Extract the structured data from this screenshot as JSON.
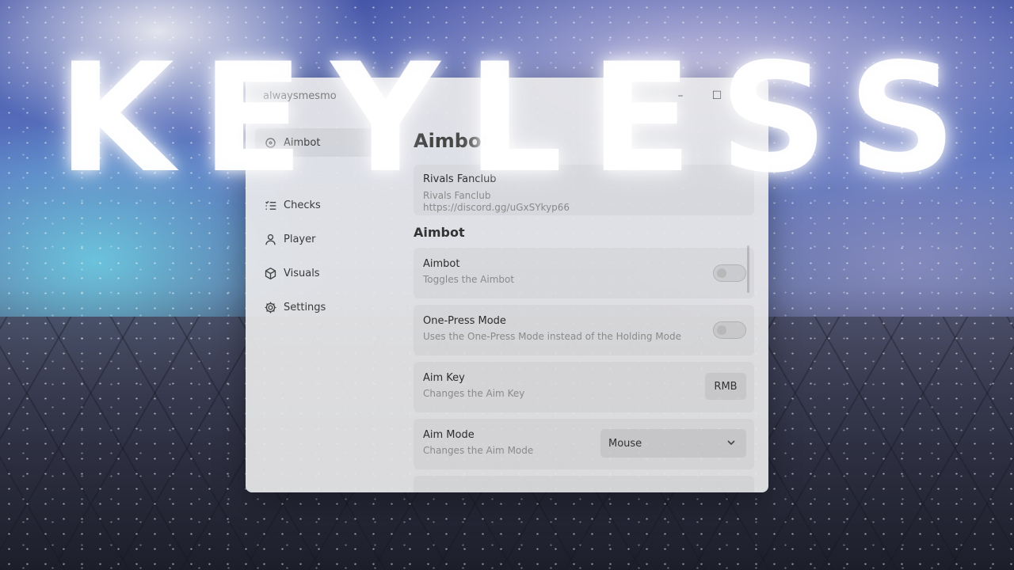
{
  "overlay": {
    "title": "KEYLESS"
  },
  "window": {
    "title": "alwaysmesmo",
    "controls": {
      "minimize": "–",
      "maximize": "☐",
      "close": "✕"
    }
  },
  "sidebar": {
    "items": [
      {
        "label": "Aimbot",
        "icon": "crosshair-icon",
        "active": true
      },
      {
        "label": "Checks",
        "icon": "checklist-icon",
        "active": false
      },
      {
        "label": "Player",
        "icon": "user-icon",
        "active": false
      },
      {
        "label": "Visuals",
        "icon": "cube-icon",
        "active": false
      },
      {
        "label": "Settings",
        "icon": "gear-icon",
        "active": false
      }
    ]
  },
  "content": {
    "page_title": "Aimbot",
    "discord": {
      "title": "Rivals Fanclub",
      "name": "Rivals Fanclub",
      "link": "https://discord.gg/uGxSYkyp66"
    },
    "section_title": "Aimbot",
    "settings": [
      {
        "title": "Aimbot",
        "desc": "Toggles the Aimbot",
        "control": "toggle",
        "value": false
      },
      {
        "title": "One-Press Mode",
        "desc": "Uses the One-Press Mode instead of the Holding Mode",
        "control": "toggle",
        "value": false
      },
      {
        "title": "Aim Key",
        "desc": "Changes the Aim Key",
        "control": "keybind",
        "value": "RMB"
      },
      {
        "title": "Aim Mode",
        "desc": "Changes the Aim Mode",
        "control": "dropdown",
        "value": "Mouse"
      }
    ]
  }
}
